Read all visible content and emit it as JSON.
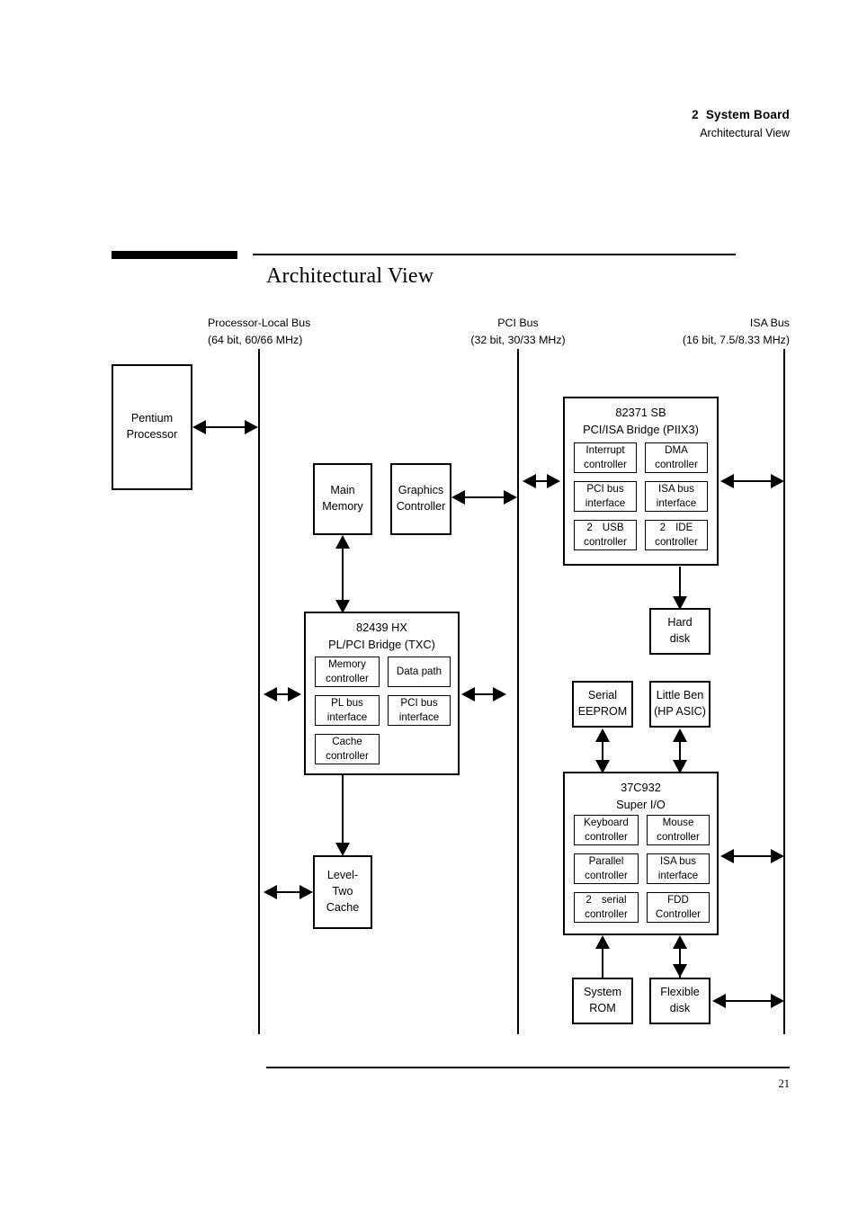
{
  "header": {
    "chapter_number": "2",
    "chapter_title": "System Board",
    "section": "Architectural View"
  },
  "title": "Architectural View",
  "footer": {
    "page_number": "21"
  },
  "buses": [
    {
      "id": "processor-local",
      "name": "Processor-Local Bus",
      "spec": "(64 bit, 60/66 MHz)"
    },
    {
      "id": "pci",
      "name": "PCI Bus",
      "spec": "(32 bit, 30/33 MHz)"
    },
    {
      "id": "isa",
      "name": "ISA Bus",
      "spec": "(16 bit, 7.5/8.33 MHz)"
    }
  ],
  "blocks": {
    "pentium": {
      "line1": "Pentium",
      "line2": "Processor"
    },
    "main_memory": {
      "line1": "Main",
      "line2": "Memory"
    },
    "graphics_controller": {
      "line1": "Graphics",
      "line2": "Controller"
    },
    "level_two_cache": {
      "line1": "Level-",
      "line2": "Two",
      "line3": "Cache"
    },
    "hard_disk": {
      "line1": "Hard",
      "line2": "disk"
    },
    "serial_eeprom": {
      "line1": "Serial",
      "line2": "EEPROM"
    },
    "little_ben": {
      "line1": "Little Ben",
      "line2": "(HP ASIC)"
    },
    "system_rom": {
      "line1": "System",
      "line2": "ROM"
    },
    "flexible_disk": {
      "line1": "Flexible",
      "line2": "disk"
    }
  },
  "chips": {
    "piix3": {
      "title_line1": "82371 SB",
      "title_line2": "PCI/ISA Bridge (PIIX3)",
      "units": [
        {
          "line1": "Interrupt",
          "line2": "controller"
        },
        {
          "line1": "DMA",
          "line2": "controller"
        },
        {
          "line1": "PCI bus",
          "line2": "interface"
        },
        {
          "line1": "ISA bus",
          "line2": "interface"
        },
        {
          "line1_pre": "2",
          "line1_post": "USB",
          "line2": "controller"
        },
        {
          "line1_pre": "2",
          "line1_post": "IDE",
          "line2": "controller"
        }
      ]
    },
    "txc": {
      "title_line1": "82439 HX",
      "title_line2": "PL/PCI Bridge (TXC)",
      "units": [
        {
          "line1": "Memory",
          "line2": "controller"
        },
        {
          "line1": "Data path",
          "line2": ""
        },
        {
          "line1": "PL bus",
          "line2": "interface"
        },
        {
          "line1": "PCI bus",
          "line2": "interface"
        },
        {
          "line1": "Cache",
          "line2": "controller"
        }
      ]
    },
    "superio": {
      "title_line1": "37C932",
      "title_line2": "Super I/O",
      "units": [
        {
          "line1": "Keyboard",
          "line2": "controller"
        },
        {
          "line1": "Mouse",
          "line2": "controller"
        },
        {
          "line1": "Parallel",
          "line2": "controller"
        },
        {
          "line1": "ISA bus",
          "line2": "interface"
        },
        {
          "line1_pre": "2",
          "line1_post": "serial",
          "line2": "controller"
        },
        {
          "line1": "FDD",
          "line2": "Controller"
        }
      ]
    }
  },
  "colors": {
    "ink": "#000000",
    "paper": "#ffffff"
  }
}
